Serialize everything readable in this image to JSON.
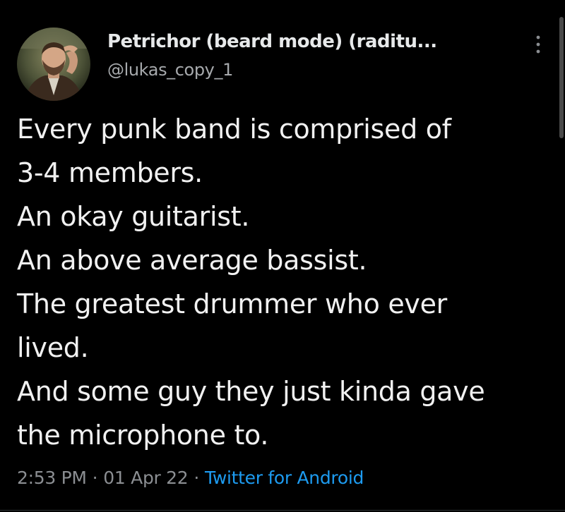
{
  "author": {
    "display_name": "Petrichor (beard mode) (raditu...",
    "handle": "@lukas_copy_1",
    "avatar_icon": "profile-photo"
  },
  "menu": {
    "more_icon": "more-vertical-icon"
  },
  "tweet": {
    "lines": [
      "Every punk band is comprised of",
      "3-4 members.",
      "An okay guitarist.",
      "An above average bassist.",
      "The greatest drummer who ever",
      "lived.",
      "And some guy they just kinda gave",
      "the microphone to."
    ]
  },
  "meta": {
    "time": "2:53 PM",
    "separator": "·",
    "date": "01 Apr 22",
    "source": "Twitter for Android"
  },
  "colors": {
    "background": "#000000",
    "text": "#e7e9ea",
    "secondary": "#8b8e92",
    "link": "#1d9bf0"
  }
}
